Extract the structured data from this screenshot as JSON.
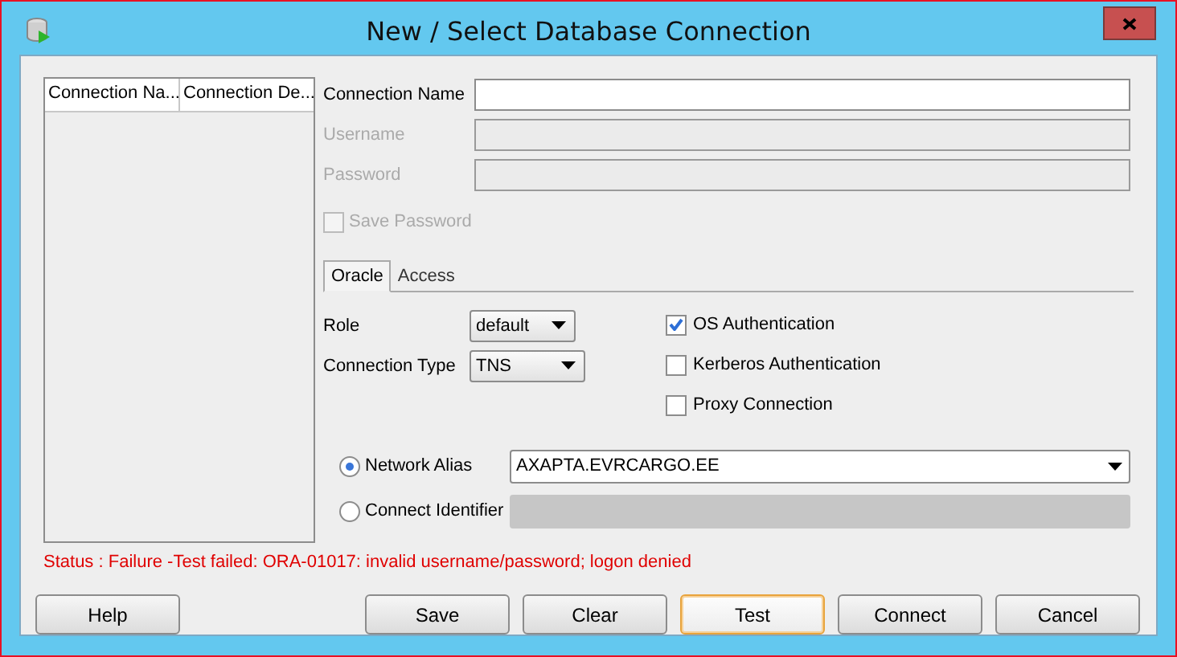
{
  "window": {
    "title": "New / Select Database Connection"
  },
  "connection_list": {
    "columns": [
      "Connection Na...",
      "Connection De..."
    ]
  },
  "fields": [
    {
      "label": "Connection Name",
      "disabled": false
    },
    {
      "label": "Username",
      "disabled": true
    },
    {
      "label": "Password",
      "disabled": true
    }
  ],
  "save_password": {
    "label": "Save Password",
    "checked": false,
    "disabled": true
  },
  "tabs": [
    {
      "label": "Oracle",
      "selected": true
    },
    {
      "label": "Access",
      "selected": false
    }
  ],
  "selects": [
    {
      "label": "Role",
      "value": "default"
    },
    {
      "label": "Connection Type",
      "value": "TNS"
    }
  ],
  "options": [
    {
      "label": "OS Authentication",
      "checked": true
    },
    {
      "label": "Kerberos Authentication",
      "checked": false
    },
    {
      "label": "Proxy Connection",
      "checked": false
    }
  ],
  "destinations": [
    {
      "label": "Network Alias",
      "selected": true,
      "value": "AXAPTA.EVRCARGO.EE"
    },
    {
      "label": "Connect Identifier",
      "selected": false
    }
  ],
  "status": "Status : Failure -Test failed: ORA-01017: invalid username/password; logon denied",
  "buttons": [
    {
      "label": "Help",
      "focused": false
    },
    {
      "label": "Save",
      "focused": false
    },
    {
      "label": "Clear",
      "focused": false
    },
    {
      "label": "Test",
      "focused": true
    },
    {
      "label": "Connect",
      "focused": false
    },
    {
      "label": "Cancel",
      "focused": false
    }
  ]
}
